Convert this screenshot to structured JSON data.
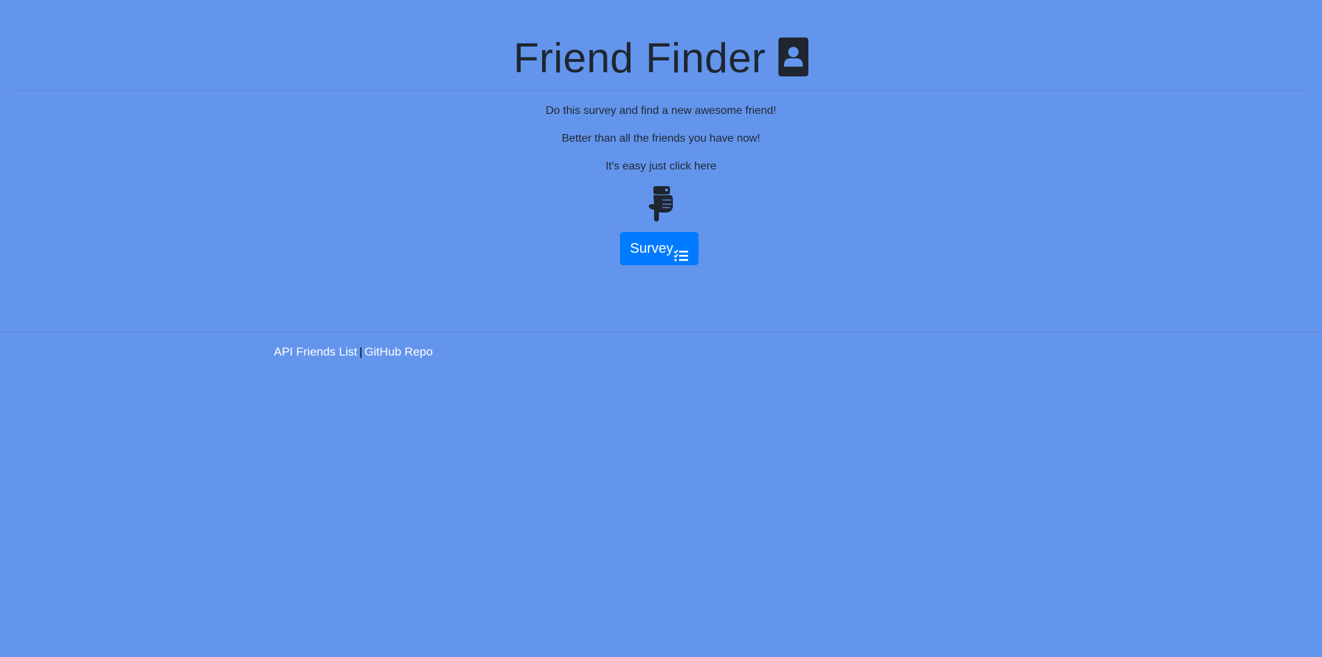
{
  "page": {
    "background_color": "#6495ED",
    "accent_color": "#007bff"
  },
  "header": {
    "title": "Friend Finder",
    "title_icon": "address-card-icon"
  },
  "intro": {
    "line1": "Do this survey and find a new awesome friend!",
    "line2": "Better than all the friends you have now!",
    "line3": "It's easy just click here",
    "pointer_icon": "hand-point-down-icon"
  },
  "survey_button": {
    "label": "Survey",
    "icon": "tasks-list-icon"
  },
  "footer": {
    "link1": "API Friends List",
    "separator": "|",
    "link2": "GitHub Repo"
  }
}
